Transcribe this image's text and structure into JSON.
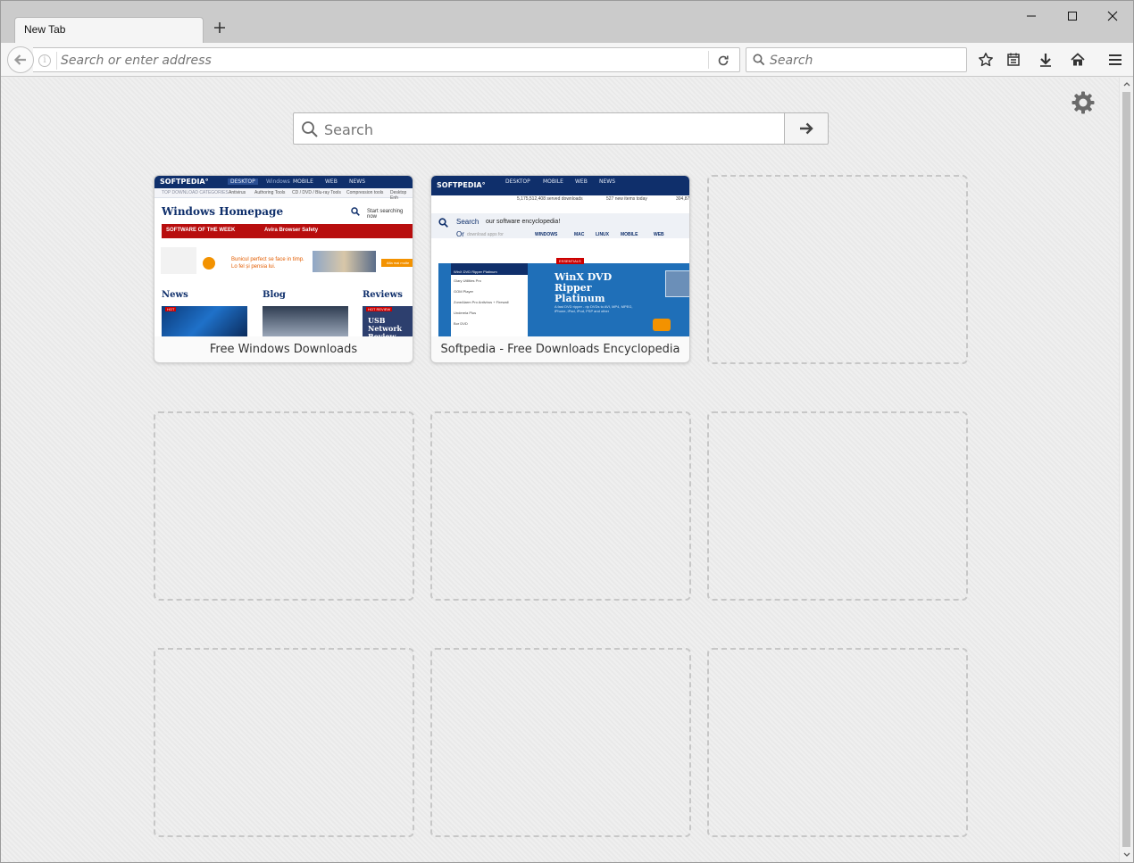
{
  "tab": {
    "title": "New Tab"
  },
  "urlbar": {
    "placeholder": "Search or enter address"
  },
  "searchbar": {
    "placeholder": "Search"
  },
  "newtab_search": {
    "placeholder": "Search"
  },
  "tiles": [
    {
      "label": "Free Windows Downloads"
    },
    {
      "label": "Softpedia - Free Downloads Encyclopedia"
    }
  ],
  "thumb1": {
    "logo": "SOFTPEDIA°",
    "nav": [
      "DESKTOP",
      "Windows",
      "MOBILE",
      "WEB",
      "NEWS"
    ],
    "sub": [
      "TOP DOWNLOAD CATEGORIES",
      "Antivirus",
      "Authoring Tools",
      "CD / DVD / Blu-ray Tools",
      "Compression tools",
      "Desktop Enh"
    ],
    "heading": "Windows Homepage",
    "search_text": "Start searching now",
    "sotw": "SOFTWARE OF THE WEEK",
    "sotw_item": "Avira Browser Safety",
    "ad_text": "Bunicul perfect se face in timp. Lo fel și pensia lui.",
    "ad_btn": "Afla mai multe",
    "sections": [
      "News",
      "Blog",
      "Reviews"
    ],
    "review_title": "USB Network Review",
    "hot": "HOT",
    "hot_review": "HOT REVIEW"
  },
  "thumb2": {
    "logo": "SOFTPEDIA°",
    "nav": [
      "DESKTOP",
      "MOBILE",
      "WEB",
      "NEWS"
    ],
    "stats": [
      "5,175,512,408 served downloads",
      "527 new items today",
      "304,87"
    ],
    "search_label": "Search",
    "search_text": "our software encyclopedia!",
    "or_text": "Or",
    "or_sub": "download apps for",
    "platforms": [
      "WINDOWS",
      "MAC",
      "LINUX",
      "MOBILE",
      "WEB"
    ],
    "list": [
      "WinX DVD Ripper Platinum",
      "Glary Utilities Pro",
      "GOM Player",
      "ZoneAlarm Pro Antivirus + Firewall",
      "Underela Plus",
      "Bor DVD"
    ],
    "badge": "ESSENTIALS",
    "feature_title": "WinX DVD Ripper Platinum",
    "feature_desc": "A fast DVD ripper - rip DVDs to AVI, MP4, MPEG, iPhone, iPad, iPod, PSP and other"
  }
}
